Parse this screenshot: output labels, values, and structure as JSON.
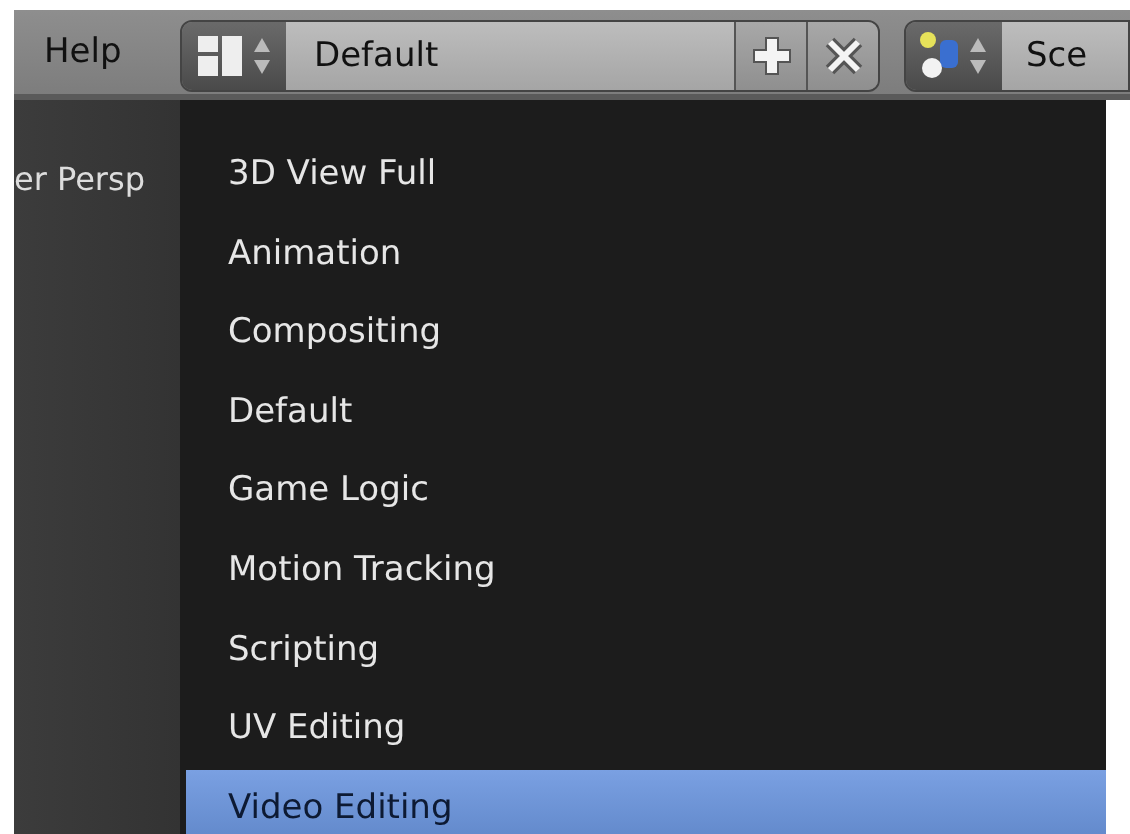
{
  "header": {
    "menu_item": "Help",
    "layout_field": {
      "value": "Default"
    },
    "scene_field": {
      "value": "Sce"
    }
  },
  "viewport": {
    "label": "er Persp"
  },
  "dropdown": {
    "items": [
      {
        "label": "3D View Full",
        "selected": false
      },
      {
        "label": "Animation",
        "selected": false
      },
      {
        "label": "Compositing",
        "selected": false
      },
      {
        "label": "Default",
        "selected": false
      },
      {
        "label": "Game Logic",
        "selected": false
      },
      {
        "label": "Motion Tracking",
        "selected": false
      },
      {
        "label": "Scripting",
        "selected": false
      },
      {
        "label": "UV Editing",
        "selected": false
      },
      {
        "label": "Video Editing",
        "selected": true
      }
    ]
  }
}
